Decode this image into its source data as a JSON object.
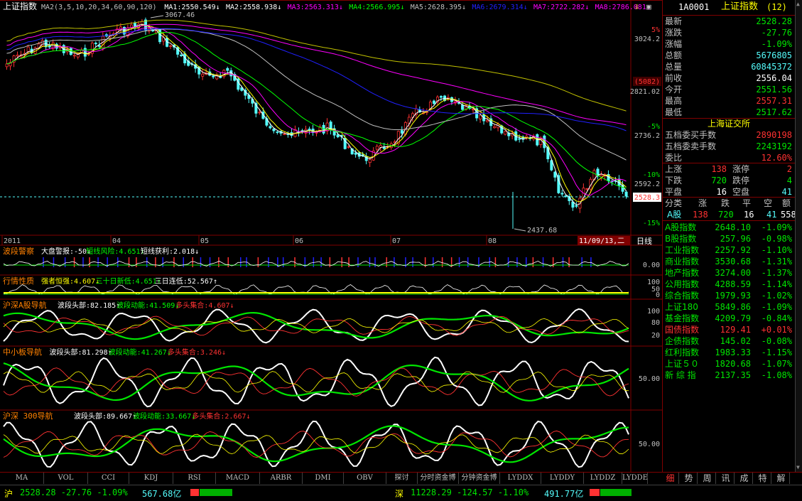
{
  "colors": {
    "up": "#ff3232",
    "down": "#54fcfc",
    "flat": "#ffffff",
    "green": "#00e600",
    "yellow": "#ffff00",
    "magenta": "#ff00ff",
    "blue": "#2020ff",
    "orange": "#ff8000"
  },
  "main_chart": {
    "title": "上证指数",
    "ma_legend": [
      {
        "label": "MA2(3,5,10,20,34,60,90,120)",
        "color": "#c0c0c0"
      },
      {
        "label": "MA1:2550.549↓",
        "color": "#ffffff"
      },
      {
        "label": "MA2:2558.938↓",
        "color": "#ffffff"
      },
      {
        "label": "MA3:2563.313↓",
        "color": "#ff00ff"
      },
      {
        "label": "MA4:2566.995↓",
        "color": "#00ff00"
      },
      {
        "label": "MA5:2628.395↓",
        "color": "#c0c0c0"
      },
      {
        "label": "MA6:2679.314↓",
        "color": "#2020ff"
      },
      {
        "label": "MA7:2722.282↓",
        "color": "#ff00ff"
      },
      {
        "label": "MA8:2786.081↓",
        "color": "#ff00ff"
      }
    ],
    "high_label": "3067.46",
    "low_label": "2437.68",
    "y_ticks": [
      "5%",
      "3024.2",
      "2821.02",
      "-5%",
      "2736.2",
      "-10%",
      "2592.2",
      "-15%"
    ],
    "y_side_labels": [
      "(5082)",
      "2528.3"
    ],
    "x_ticks": [
      "2011",
      "04",
      "05",
      "06",
      "07",
      "08"
    ],
    "date_label": "11/09/13,二",
    "period": "日线"
  },
  "panels": [
    {
      "name": "波段警察",
      "items": [
        {
          "t": "大盘警报:-50↓",
          "c": "#ffffff"
        },
        {
          "t": "短线风险:4.651↑",
          "c": "#00ff00"
        },
        {
          "t": "短线获利:2.018↓",
          "c": "#ffffff"
        }
      ],
      "axis": [
        "0.00"
      ]
    },
    {
      "name": "行情性质",
      "items": [
        {
          "t": "强者恒强:4.607↓",
          "c": "#ffff00"
        },
        {
          "t": "三十日新低:4.651↑",
          "c": "#00ff00"
        },
        {
          "t": "三日连低:52.567↑",
          "c": "#ffffff"
        }
      ],
      "axis": [
        "100",
        "50",
        "0"
      ]
    },
    {
      "name": "沪深A股导航",
      "items": [
        {
          "t": "波段头部:82.185↑",
          "c": "#ffffff"
        },
        {
          "t": "波段动能:41.509↓",
          "c": "#00ff00"
        },
        {
          "t": "多头集合:4.607↓",
          "c": "#ff3232"
        }
      ],
      "axis": [
        "100",
        "80",
        "20"
      ]
    },
    {
      "name": "中小板导航",
      "items": [
        {
          "t": "波段头部:81.298↑",
          "c": "#ffffff"
        },
        {
          "t": "波段动能:41.267↓",
          "c": "#00ff00"
        },
        {
          "t": "多头集合:3.246↓",
          "c": "#ff3232"
        }
      ],
      "axis": [
        "50.00"
      ]
    },
    {
      "name": "沪深 300导航",
      "items": [
        {
          "t": "波段头部:89.667↑",
          "c": "#ffffff"
        },
        {
          "t": "波段动能:33.667↓",
          "c": "#00ff00"
        },
        {
          "t": "多头集合:2.667↓",
          "c": "#ff3232"
        }
      ],
      "axis": [
        "50.00"
      ]
    }
  ],
  "bottom_tabs": [
    "MA",
    "VOL",
    "CCI",
    "KDJ",
    "RSI",
    "MACD",
    "ARBR",
    "DMI",
    "OBV",
    "探讨",
    "分时资金博",
    "分钟资金博",
    "LYDDX",
    "LYDDY",
    "LYDDZ",
    "LYDDE"
  ],
  "right_panel": {
    "code": "1A0001",
    "name": "上证指数",
    "count": "(12)",
    "quote": [
      {
        "label": "最新",
        "value": "2528.28",
        "color": "#00e600"
      },
      {
        "label": "涨跌",
        "value": "-27.76",
        "color": "#00e600"
      },
      {
        "label": "涨幅",
        "value": "-1.09%",
        "color": "#00e600"
      },
      {
        "label": "总额",
        "value": "5676805",
        "color": "#54fcfc"
      },
      {
        "label": "总量",
        "value": "60845372",
        "color": "#54fcfc"
      },
      {
        "label": "前收",
        "value": "2556.04",
        "color": "#ffffff"
      },
      {
        "label": "今开",
        "value": "2551.56",
        "color": "#00e600"
      },
      {
        "label": "最高",
        "value": "2557.31",
        "color": "#ff3232"
      },
      {
        "label": "最低",
        "value": "2517.62",
        "color": "#00e600"
      }
    ],
    "exchange": "上海证交所",
    "orders": [
      {
        "label": "五档委买手数",
        "value": "2890198",
        "color": "#ff3232"
      },
      {
        "label": "五档委卖手数",
        "value": "2243192",
        "color": "#00e600"
      },
      {
        "label": "委比",
        "value": "12.60%",
        "color": "#ff3232"
      }
    ],
    "breadth": [
      {
        "l1": "上涨",
        "v1": "138",
        "l2": "涨停",
        "v2": "2",
        "c1": "#ff3232",
        "c2": "#ff3232"
      },
      {
        "l1": "下跌",
        "v1": "720",
        "l2": "跌停",
        "v2": "4",
        "c1": "#00e600",
        "c2": "#00e600"
      },
      {
        "l1": "平盘",
        "v1": "16",
        "l2": "空盘",
        "v2": "41",
        "c1": "#ffffff",
        "c2": "#54fcfc"
      }
    ],
    "cat_header": [
      "分类",
      "涨",
      "跌",
      "平",
      "空",
      "额"
    ],
    "cat_row": {
      "name": "A股",
      "v": [
        "138",
        "720",
        "16",
        "41",
        "558"
      ]
    },
    "indices": [
      {
        "name": "A股指数",
        "value": "2648.10",
        "chg": "-1.09%"
      },
      {
        "name": "B股指数",
        "value": "257.96",
        "chg": "-0.98%"
      },
      {
        "name": "工业指数",
        "value": "2257.92",
        "chg": "-1.10%"
      },
      {
        "name": "商业指数",
        "value": "3530.68",
        "chg": "-1.31%"
      },
      {
        "name": "地产指数",
        "value": "3274.00",
        "chg": "-1.37%"
      },
      {
        "name": "公用指数",
        "value": "4288.59",
        "chg": "-1.14%"
      },
      {
        "name": "综合指数",
        "value": "1979.93",
        "chg": "-1.02%"
      },
      {
        "name": "上证180",
        "value": "5849.86",
        "chg": "-1.09%"
      },
      {
        "name": "基金指数",
        "value": "4209.79",
        "chg": "-0.84%"
      },
      {
        "name": "国债指数",
        "value": "129.41",
        "chg": "+0.01%"
      },
      {
        "name": "企债指数",
        "value": "145.02",
        "chg": "-0.08%"
      },
      {
        "name": "红利指数",
        "value": "1983.33",
        "chg": "-1.15%"
      },
      {
        "name": "上证５０",
        "value": "1820.68",
        "chg": "-1.07%"
      },
      {
        "name": "新 综 指",
        "value": "2137.35",
        "chg": "-1.08%"
      }
    ],
    "tabs": [
      "细",
      "势",
      "周",
      "讯",
      "成",
      "特",
      "解"
    ]
  },
  "status_bar": {
    "sh_prefix": "沪",
    "sh_text": "2528.28  -27.76 -1.09%",
    "sh_amt": "567.68亿",
    "sz_prefix": "深",
    "sz_text": "11228.29  -124.57 -1.10%",
    "sz_amt": "491.77亿"
  }
}
